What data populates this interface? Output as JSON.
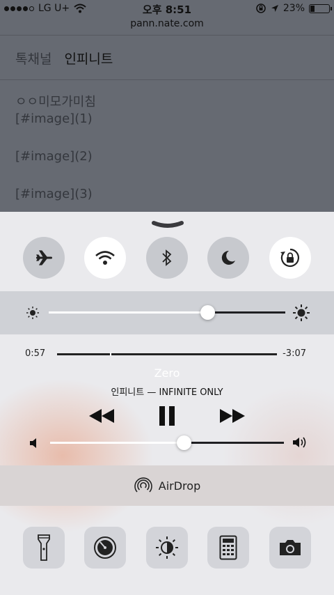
{
  "status_bar": {
    "carrier": "LG U+",
    "time": "오후 8:51",
    "battery": "23%",
    "battery_level": 0.23
  },
  "browser": {
    "url": "pann.nate.com"
  },
  "page": {
    "tabs": [
      "톡채널",
      "인피니트"
    ],
    "lines": [
      "ㅇㅇ미모가미침",
      "[#image](1)",
      "[#image](2)",
      "[#image](3)"
    ]
  },
  "control_center": {
    "toggles": [
      {
        "name": "airplane-mode-toggle",
        "icon": "airplane-icon",
        "on": false
      },
      {
        "name": "wifi-toggle",
        "icon": "wifi-icon",
        "on": true
      },
      {
        "name": "bluetooth-toggle",
        "icon": "bluetooth-icon",
        "on": false
      },
      {
        "name": "do-not-disturb-toggle",
        "icon": "moon-icon",
        "on": false
      },
      {
        "name": "rotation-lock-toggle",
        "icon": "rotation-lock-icon",
        "on": true
      }
    ],
    "brightness_level": 0.67,
    "now_playing": {
      "elapsed": "0:57",
      "remaining": "-3:07",
      "progress": 0.24,
      "title": "Zero",
      "artist_album": "인피니트 — INFINITE ONLY"
    },
    "volume_level": 0.57,
    "airdrop_label": "AirDrop",
    "shortcuts": [
      "flashlight-icon",
      "timer-icon",
      "night-shift-icon",
      "calculator-icon",
      "camera-icon"
    ]
  }
}
